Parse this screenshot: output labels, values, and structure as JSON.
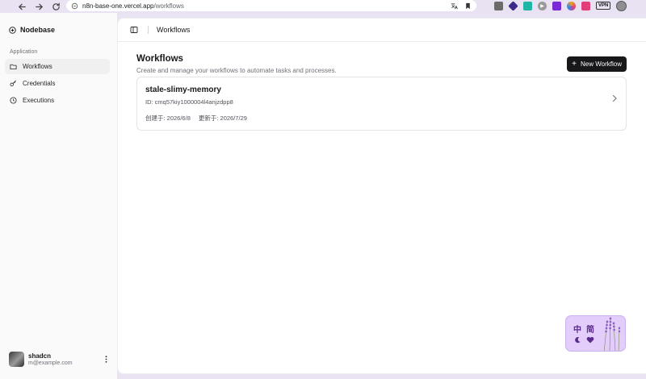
{
  "browser": {
    "url_host": "n8n-base-one.vercel.app",
    "url_path": "/workflows",
    "vpn_label": "VPN",
    "extensions": [
      {
        "name": "grid-icon",
        "color": "#6b6b6b"
      },
      {
        "name": "diamond-icon",
        "color": "#3b2a8a"
      },
      {
        "name": "teal-square-icon",
        "color": "#1fb6a6"
      },
      {
        "name": "play-circle-icon",
        "color": "#9a9a9a"
      },
      {
        "name": "purple-app-icon",
        "color": "#7b2bd6"
      },
      {
        "name": "colorful-app-icon",
        "color": "#f0a020"
      },
      {
        "name": "pink-app-icon",
        "color": "#e23e7a"
      }
    ]
  },
  "sidebar": {
    "brand": "Nodebase",
    "section_label": "Application",
    "items": [
      {
        "label": "Workflows",
        "icon": "folder-icon",
        "active": true
      },
      {
        "label": "Credentials",
        "icon": "key-icon",
        "active": false
      },
      {
        "label": "Executions",
        "icon": "clock-icon",
        "active": false
      }
    ],
    "user": {
      "name": "shadcn",
      "email": "m@example.com"
    }
  },
  "topbar": {
    "title": "Workflows"
  },
  "page": {
    "title": "Workflows",
    "description": "Create and manage your workflows to automate tasks and processes.",
    "new_button": "New Workflow"
  },
  "workflows": [
    {
      "name": "stale-slimy-memory",
      "id_text": "ID: cmq57kiy1000004l4anjzdpp8",
      "created": "创建于: 2026/6/8",
      "updated": "更新于: 2026/7/29"
    }
  ],
  "widget": {
    "char1": "中",
    "char2": "简"
  },
  "colors": {
    "accent": "#18181b",
    "widget_bg": "#e3cdfa",
    "sidebar_bg": "#fafafa"
  }
}
